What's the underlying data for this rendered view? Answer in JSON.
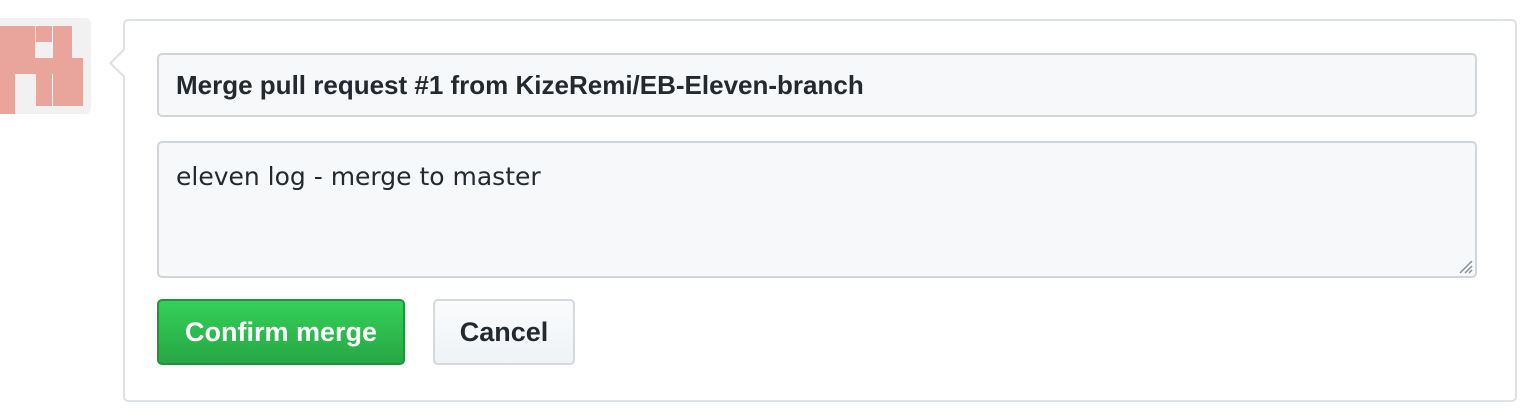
{
  "avatar": {
    "icon": "identicon",
    "color": "#e9a59b"
  },
  "merge_form": {
    "title_value": "Merge pull request #1 from KizeRemi/EB-Eleven-branch",
    "message_value": "eleven log - merge to master",
    "confirm_label": "Confirm merge",
    "cancel_label": "Cancel"
  },
  "colors": {
    "confirm_green": "#2cbe4e",
    "border_gray": "#d1d5da",
    "field_bg": "#f6f8fa",
    "text": "#24292e"
  }
}
